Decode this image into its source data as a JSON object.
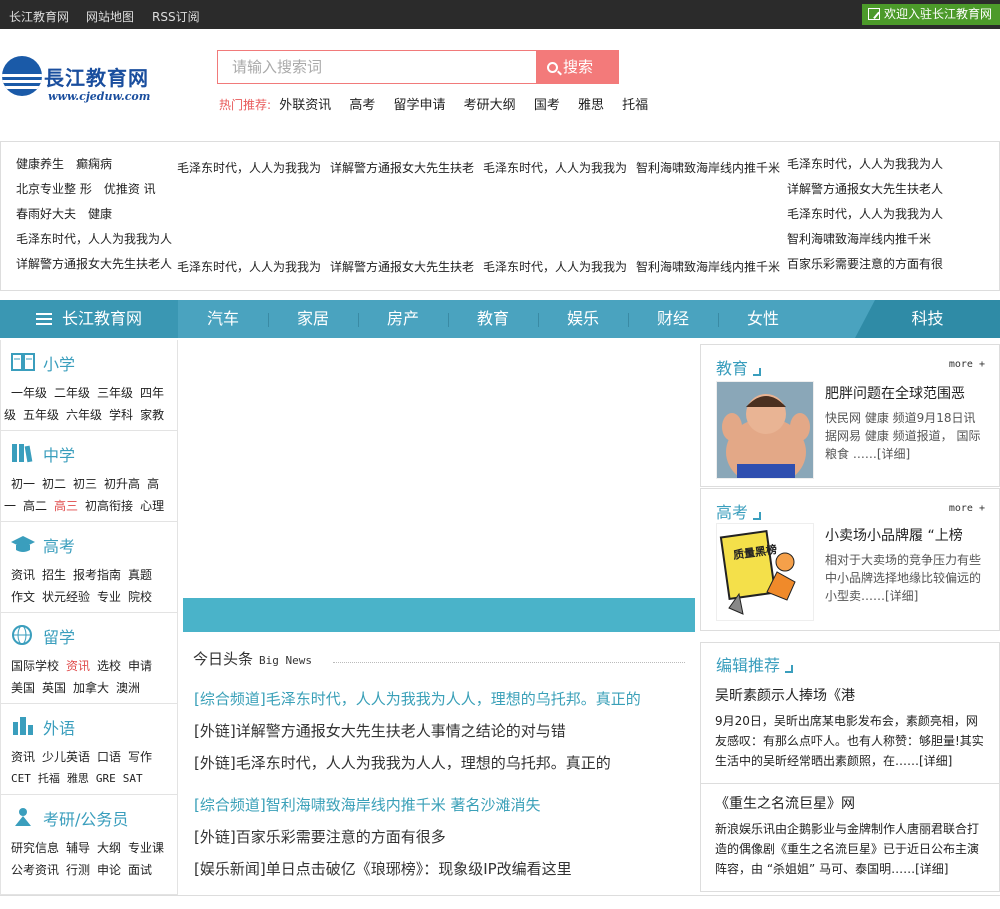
{
  "topbar": {
    "links": [
      "长江教育网",
      "网站地图",
      "RSS订阅"
    ],
    "welcome": "欢迎入驻长江教育网"
  },
  "logo": {
    "title": "長江教育网",
    "url": "www.cjeduw.com"
  },
  "search": {
    "placeholder": "请输入搜索词",
    "button": "搜索"
  },
  "hot": {
    "label": "热门推荐:",
    "items": [
      "外联资讯",
      "高考",
      "留学申请",
      "考研大纲",
      "国考",
      "雅思",
      "托福"
    ]
  },
  "ads": {
    "left": [
      "健康养生　癫痫病",
      "北京专业整 形　优推资 讯",
      "春雨好大夫　健康",
      "毛泽东时代，人人为我我为人",
      "详解警方通报女大先生扶老人"
    ],
    "middle_top": [
      "毛泽东时代，人人为我我为",
      "详解警方通报女大先生扶老",
      "毛泽东时代，人人为我我为",
      "智利海啸致海岸线内推千米"
    ],
    "middle_bottom": [
      "毛泽东时代，人人为我我为",
      "详解警方通报女大先生扶老",
      "毛泽东时代，人人为我我为",
      "智利海啸致海岸线内推千米"
    ],
    "right": [
      "毛泽东时代，人人为我我为人",
      "详解警方通报女大先生扶老人",
      "毛泽东时代，人人为我我为人",
      " 智利海啸致海岸线内推千米",
      "百家乐彩需要注意的方面有很"
    ]
  },
  "nav": {
    "home": "长江教育网",
    "items": [
      "汽车",
      "家居",
      "房产",
      "教育",
      "娱乐",
      "财经",
      "女性"
    ],
    "tech": "科技"
  },
  "categories": [
    {
      "title": "小学",
      "icon": "book-icon",
      "line1": [
        "一年级",
        "二年级",
        "三年级",
        "四年"
      ],
      "line2": [
        "级",
        "五年级",
        "六年级",
        "学科",
        "家教"
      ]
    },
    {
      "title": "中学",
      "icon": "books-icon",
      "line1": [
        "初一",
        "初二",
        "初三",
        "初升高",
        "高"
      ],
      "line2": [
        "一",
        "高二",
        "高三",
        "初高衔接",
        "心理"
      ]
    },
    {
      "title": "高考",
      "icon": "graduation-cap-icon",
      "line1": [
        "资讯",
        "招生",
        "报考指南",
        "真题"
      ],
      "line2": [
        "作文",
        "状元经验",
        "专业",
        "院校"
      ]
    },
    {
      "title": "留学",
      "icon": "globe-icon",
      "line1": [
        "国际学校",
        "资讯",
        "选校",
        "申请"
      ],
      "line2": [
        "美国",
        "英国",
        "加拿大",
        "澳洲"
      ]
    },
    {
      "title": "外语",
      "icon": "city-icon",
      "line1": [
        "资讯",
        "少儿英语",
        "口语",
        "写作"
      ],
      "line2": [
        "CET",
        "托福",
        "雅思",
        "GRE",
        "SAT"
      ]
    },
    {
      "title": "考研/公务员",
      "icon": "person-icon",
      "line1": [
        "研究信息",
        "辅导",
        "大纲",
        "专业课"
      ],
      "line2": [
        "公考资讯",
        "行测",
        "申论",
        "面试"
      ]
    }
  ],
  "headlines": {
    "title": "今日头条",
    "subtitle": "Big News",
    "items": [
      "[综合频道]毛泽东时代，人人为我我为人人，理想的乌托邦。真正的",
      "[外链]详解警方通报女大先生扶老人事情之结论的对与错",
      "[外链]毛泽东时代，人人为我我为人人，理想的乌托邦。真正的",
      "[综合频道]智利海啸致海岸线内推千米 著名沙滩消失",
      "[外链]百家乐彩需要注意的方面有很多",
      "[娱乐新闻]单日点击破亿《琅琊榜》：现象级IP改编看这里"
    ]
  },
  "right": {
    "edu": {
      "title": "教育",
      "more": "more +",
      "headline": "肥胖问题在全球范围恶",
      "desc": "快民网 健康 频道9月18日讯 据网易 健康 频道报道， 国际 粮食 ……[详细]"
    },
    "gaokao": {
      "title": "高考",
      "more": "more +",
      "headline": "小卖场小品牌履 “上榜",
      "desc": "相对于大卖场的竞争压力有些 中小品牌选择地缘比较偏远的 小型卖……[详细]",
      "img_text": "质量黑榜"
    },
    "editor": {
      "title": "编辑推荐",
      "a1_title": "吴昕素颜示人捧场《港",
      "a1_desc": "9月20日，吴昕出席某电影发布会，素颜亮相，网友感叹：有那么点吓人。也有人称赞：够胆量!其实生活中的吴昕经常晒出素颜照，在……[详细]",
      "a2_title": "《重生之名流巨星》网",
      "a2_desc": "新浪娱乐讯由企鹅影业与金牌制作人唐丽君联合打造的偶像剧《重生之名流巨星》已于近日公布主演阵容，由 “杀姐姐” 马可、泰国明……[详细]"
    }
  }
}
